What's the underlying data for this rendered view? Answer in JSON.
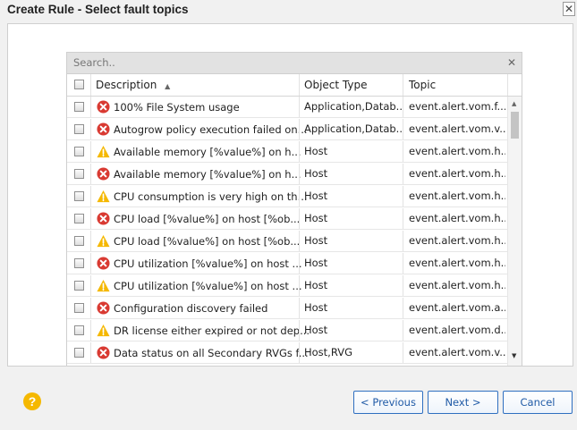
{
  "dialog": {
    "title": "Create Rule - Select fault topics",
    "close_glyph": "✕"
  },
  "grid": {
    "search_placeholder": "Search..",
    "search_clear_glyph": "✕",
    "headers": {
      "description": "Description",
      "sort_indicator": "▲",
      "object_type": "Object Type",
      "topic": "Topic"
    },
    "rows": [
      {
        "severity": "error",
        "description": "100% File System usage",
        "object_type": "Application,Datab...",
        "topic": "event.alert.vom.f..."
      },
      {
        "severity": "error",
        "description": "Autogrow policy execution failed on...",
        "object_type": "Application,Datab...",
        "topic": "event.alert.vom.v..."
      },
      {
        "severity": "warning",
        "description": "Available memory [%value%] on h...",
        "object_type": "Host",
        "topic": "event.alert.vom.h..."
      },
      {
        "severity": "error",
        "description": "Available memory [%value%] on h...",
        "object_type": "Host",
        "topic": "event.alert.vom.h..."
      },
      {
        "severity": "warning",
        "description": "CPU consumption is very high on th...",
        "object_type": "Host",
        "topic": "event.alert.vom.h..."
      },
      {
        "severity": "error",
        "description": "CPU load [%value%] on host [%ob...",
        "object_type": "Host",
        "topic": "event.alert.vom.h..."
      },
      {
        "severity": "warning",
        "description": "CPU load [%value%] on host [%ob...",
        "object_type": "Host",
        "topic": "event.alert.vom.h..."
      },
      {
        "severity": "error",
        "description": "CPU utilization [%value%] on host ...",
        "object_type": "Host",
        "topic": "event.alert.vom.h..."
      },
      {
        "severity": "warning",
        "description": "CPU utilization [%value%] on host ...",
        "object_type": "Host",
        "topic": "event.alert.vom.h..."
      },
      {
        "severity": "error",
        "description": "Configuration discovery failed",
        "object_type": "Host",
        "topic": "event.alert.vom.a..."
      },
      {
        "severity": "warning",
        "description": "DR license either expired or not dep...",
        "object_type": "Host",
        "topic": "event.alert.vom.d..."
      },
      {
        "severity": "error",
        "description": "Data status on all Secondary RVGs f...",
        "object_type": "Host,RVG",
        "topic": "event.alert.vom.v..."
      }
    ],
    "scroll_up_glyph": "▲",
    "scroll_down_glyph": "▼"
  },
  "footer": {
    "help_glyph": "?",
    "previous_label": "< Previous",
    "next_label": "Next >",
    "cancel_label": "Cancel"
  },
  "colors": {
    "error": "#d93a32",
    "warning": "#f5b800",
    "button_text": "#1f5aa6"
  }
}
